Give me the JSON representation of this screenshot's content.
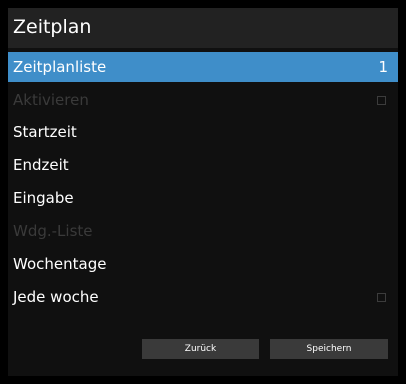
{
  "header": {
    "title": "Zeitplan"
  },
  "menu": {
    "items": [
      {
        "label": "Zeitplanliste",
        "value": "1"
      },
      {
        "label": "Aktivieren"
      },
      {
        "label": "Startzeit"
      },
      {
        "label": "Endzeit"
      },
      {
        "label": "Eingabe"
      },
      {
        "label": "Wdg.-Liste"
      },
      {
        "label": "Wochentage"
      },
      {
        "label": "Jede woche"
      }
    ]
  },
  "buttons": {
    "back": "Zurück",
    "save": "Speichern"
  },
  "colors": {
    "highlight": "#3f8ec9",
    "panel": "#101010",
    "header": "#222222",
    "disabled_text": "#3a3a3a",
    "button": "#3a3a3a"
  }
}
